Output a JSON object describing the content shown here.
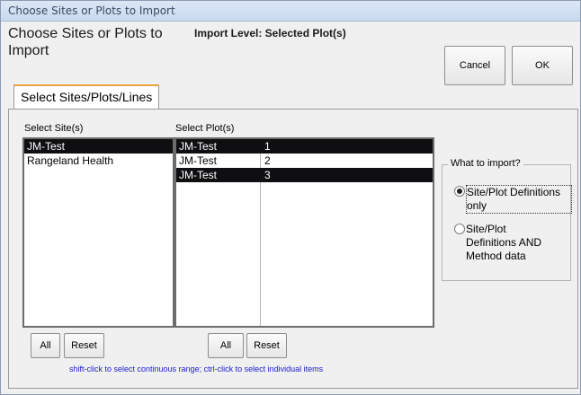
{
  "window": {
    "title": "Choose Sites or Plots to Import"
  },
  "header": {
    "heading": "Choose Sites or Plots to Import",
    "import_level": "Import Level: Selected Plot(s)",
    "cancel_label": "Cancel",
    "ok_label": "OK"
  },
  "tabs": [
    {
      "label": "Select Sites/Plots/Lines",
      "selected": true
    }
  ],
  "sites": {
    "label": "Select Site(s)",
    "items": [
      {
        "name": "JM-Test",
        "selected": true
      },
      {
        "name": "Rangeland Health",
        "selected": false
      }
    ],
    "all_label": "All",
    "reset_label": "Reset"
  },
  "plots": {
    "label": "Select Plot(s)",
    "rows": [
      {
        "site": "JM-Test",
        "plot": "1",
        "selected": true
      },
      {
        "site": "JM-Test",
        "plot": "2",
        "selected": false
      },
      {
        "site": "JM-Test",
        "plot": "3",
        "selected": true
      }
    ],
    "all_label": "All",
    "reset_label": "Reset"
  },
  "what_to_import": {
    "legend": "What to import?",
    "options": [
      {
        "label": "Site/Plot Definitions only",
        "checked": true
      },
      {
        "label": "Site/Plot Definitions AND Method data",
        "checked": false
      }
    ]
  },
  "hint": "shift-click to select continuous range; ctrl-click to select individual items",
  "colors": {
    "selection": "#0f0f12",
    "hint_text": "#1a1ad0",
    "tab_accent": "#e8a33d"
  }
}
